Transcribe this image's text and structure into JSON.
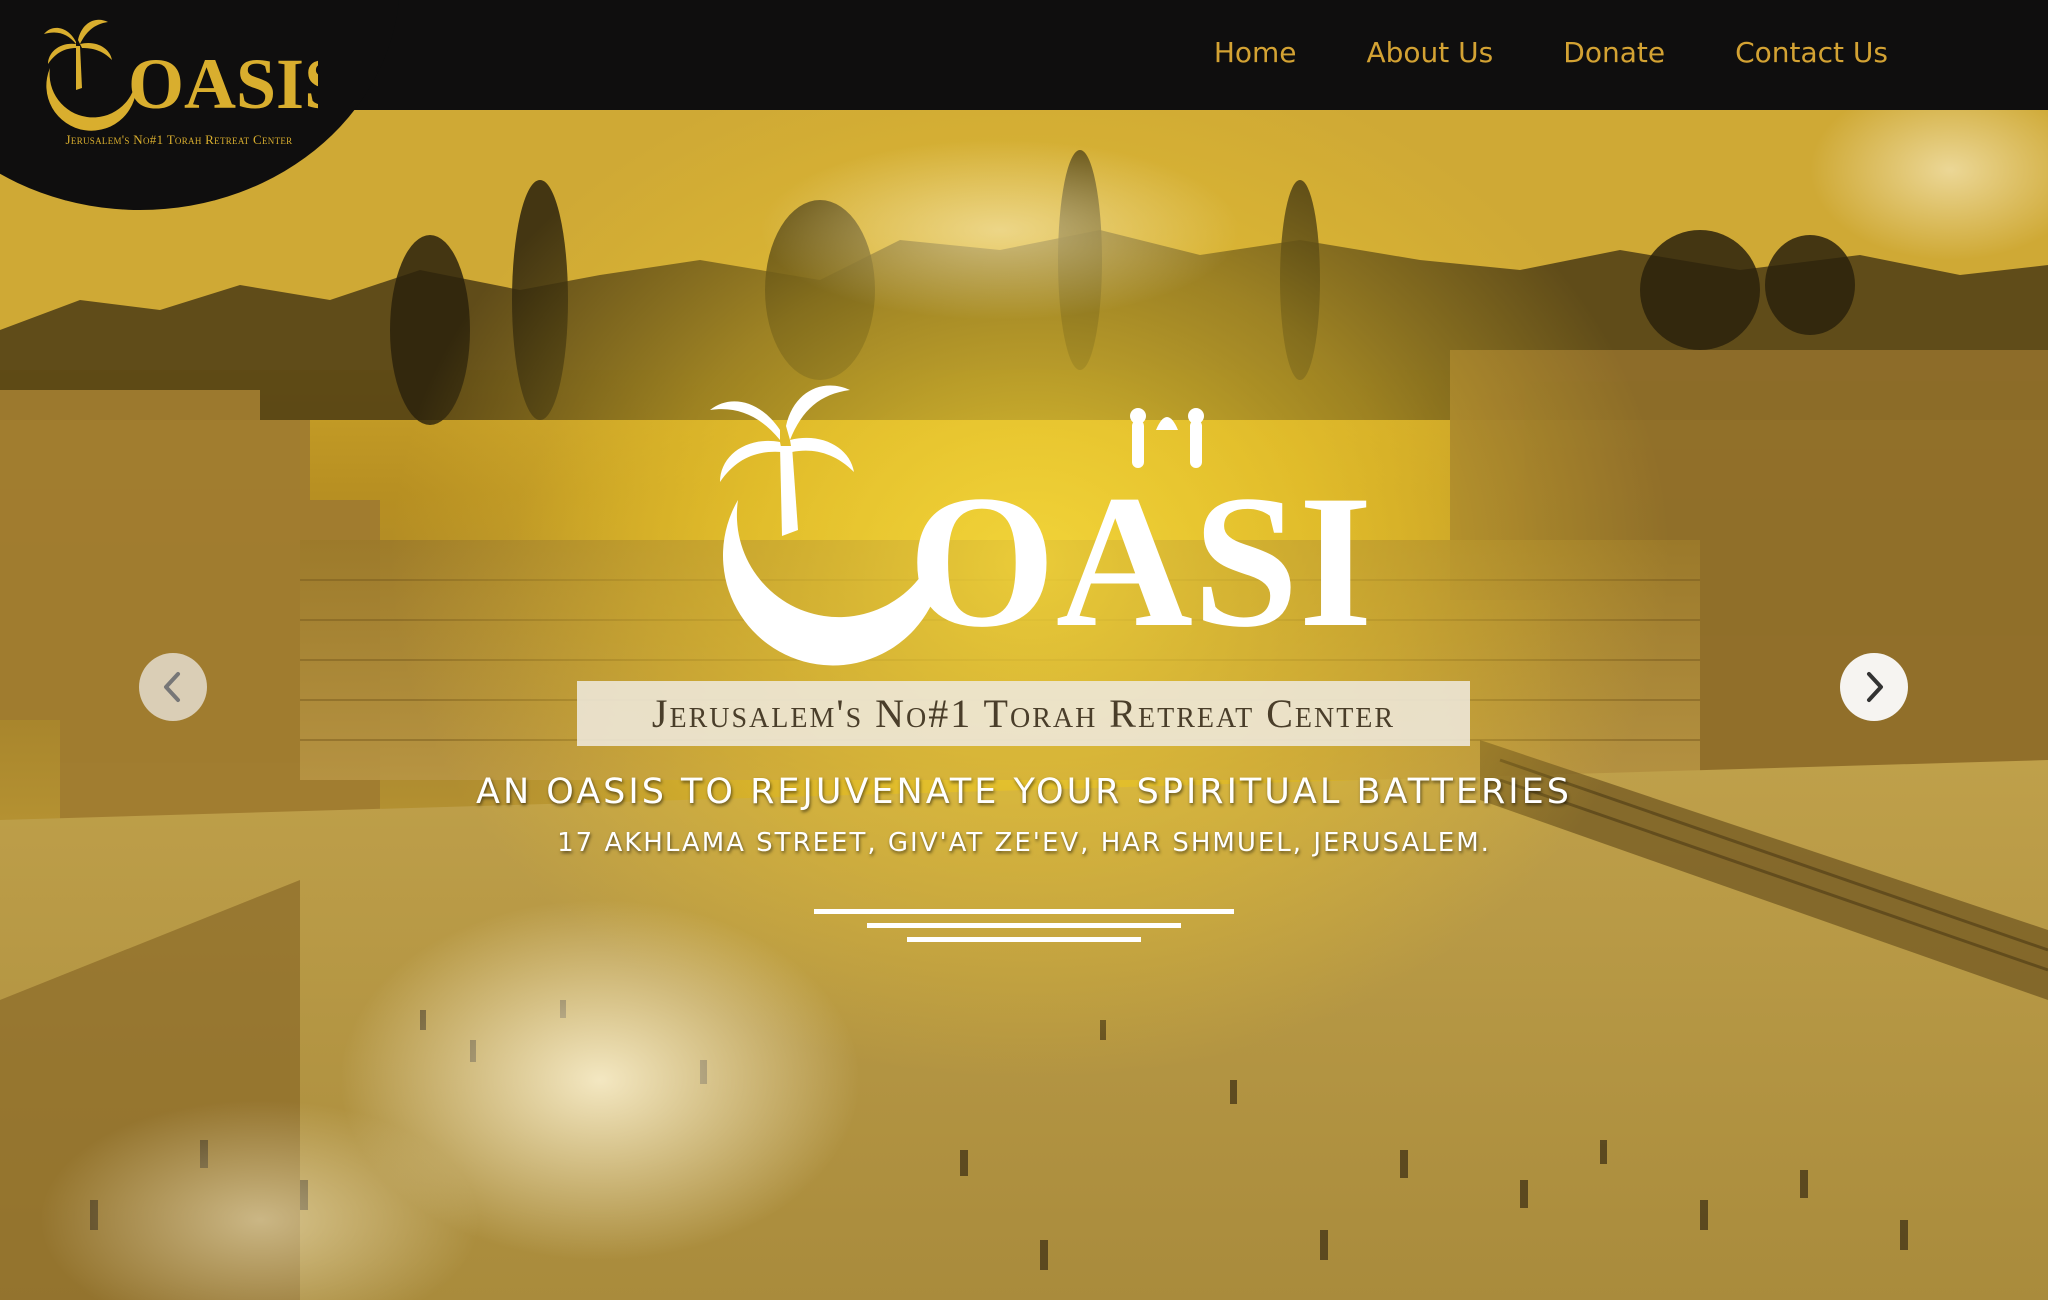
{
  "header": {
    "logo_text": "OASIS",
    "logo_tagline": "Jerusalem's No#1 Torah Retreat Center",
    "nav": [
      {
        "label": "Home"
      },
      {
        "label": "About Us"
      },
      {
        "label": "Donate"
      },
      {
        "label": "Contact Us"
      }
    ]
  },
  "hero": {
    "logo_text": "OASIS",
    "tagline": "Jerusalem's No#1 Torah Retreat Center",
    "headline": "AN OASIS TO REJUVENATE YOUR SPIRITUAL BATTERIES",
    "address": "17 AKHLAMA STREET, GIV'AT ZE'EV, HAR SHMUEL, JERUSALEM.",
    "prev_icon": "chevron-left-icon",
    "next_icon": "chevron-right-icon"
  },
  "colors": {
    "header_bg": "#0f0e0e",
    "nav_text": "#d3a233",
    "gold": "#d9ae2e",
    "overlay_yellow": "#e0bb2c"
  }
}
